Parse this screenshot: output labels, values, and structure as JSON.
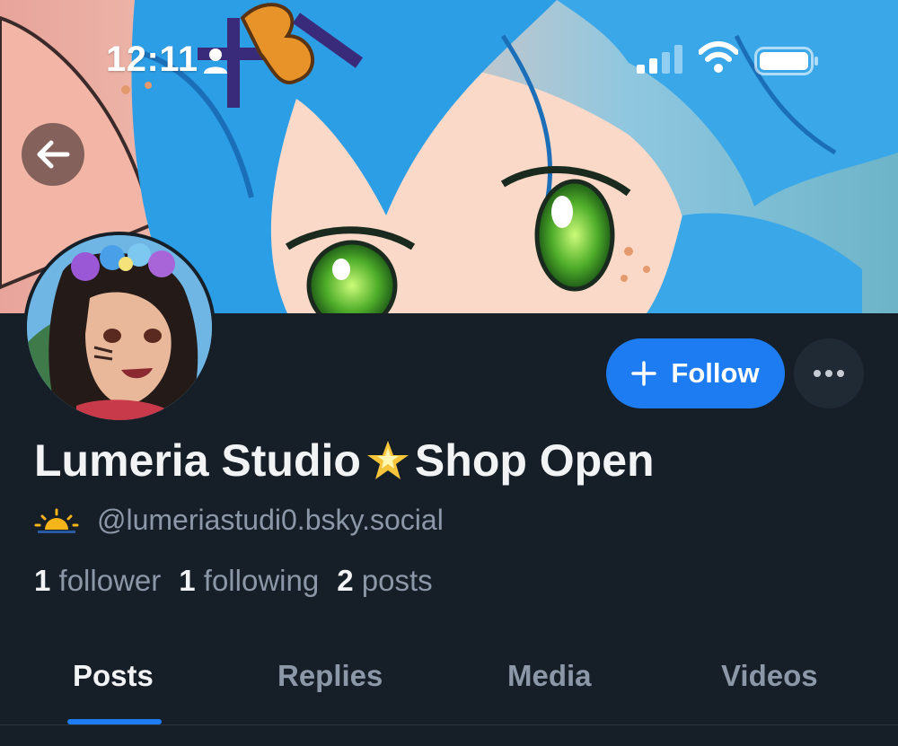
{
  "status_bar": {
    "time": "12:11",
    "icons": [
      "person-icon",
      "signal-icon",
      "wifi-icon",
      "battery-icon"
    ]
  },
  "navigation": {
    "back_icon": "arrow-left-icon"
  },
  "profile": {
    "display_name_part1": "Lumeria Studio",
    "display_name_emoji": "star-icon",
    "display_name_part2": "Shop Open",
    "handle": "@lumeriastudi0.bsky.social",
    "handle_prefix_icon": "sunrise-icon",
    "followers_count": "1",
    "followers_label": "follower",
    "following_count": "1",
    "following_label": "following",
    "posts_count": "2",
    "posts_label": "posts"
  },
  "actions": {
    "follow_label": "Follow",
    "follow_icon": "plus-icon",
    "more_icon": "ellipsis-icon"
  },
  "tabs": [
    {
      "label": "Posts",
      "active": true
    },
    {
      "label": "Replies",
      "active": false
    },
    {
      "label": "Media",
      "active": false
    },
    {
      "label": "Videos",
      "active": false
    }
  ],
  "colors": {
    "background": "#161e27",
    "accent": "#1d7cf2",
    "muted_text": "#8c98a8"
  }
}
